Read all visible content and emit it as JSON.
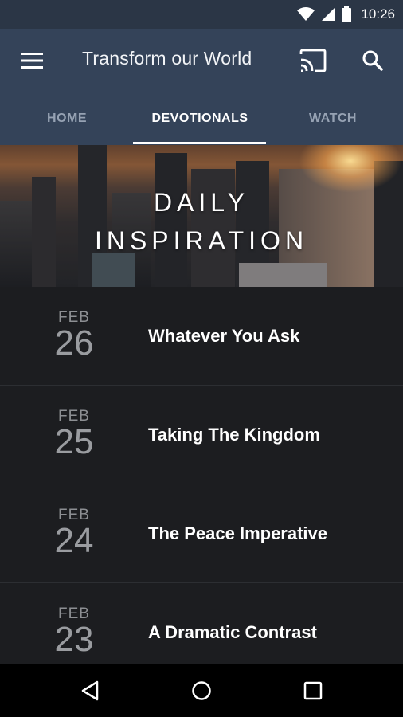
{
  "status_bar": {
    "time": "10:26"
  },
  "toolbar": {
    "title": "Transform our World"
  },
  "tabs": [
    {
      "label": "HOME"
    },
    {
      "label": "DEVOTIONALS"
    },
    {
      "label": "WATCH"
    }
  ],
  "hero": {
    "line1": "DAILY",
    "line2": "INSPIRATION"
  },
  "devotionals": [
    {
      "month": "FEB",
      "day": "26",
      "title": "Whatever You Ask"
    },
    {
      "month": "FEB",
      "day": "25",
      "title": "Taking The Kingdom"
    },
    {
      "month": "FEB",
      "day": "24",
      "title": "The Peace Imperative"
    },
    {
      "month": "FEB",
      "day": "23",
      "title": "A Dramatic Contrast"
    }
  ],
  "colors": {
    "toolbar": "#344359",
    "status_bar": "#2b3646",
    "list_bg": "#1c1d20",
    "nav_bar": "#000000"
  }
}
